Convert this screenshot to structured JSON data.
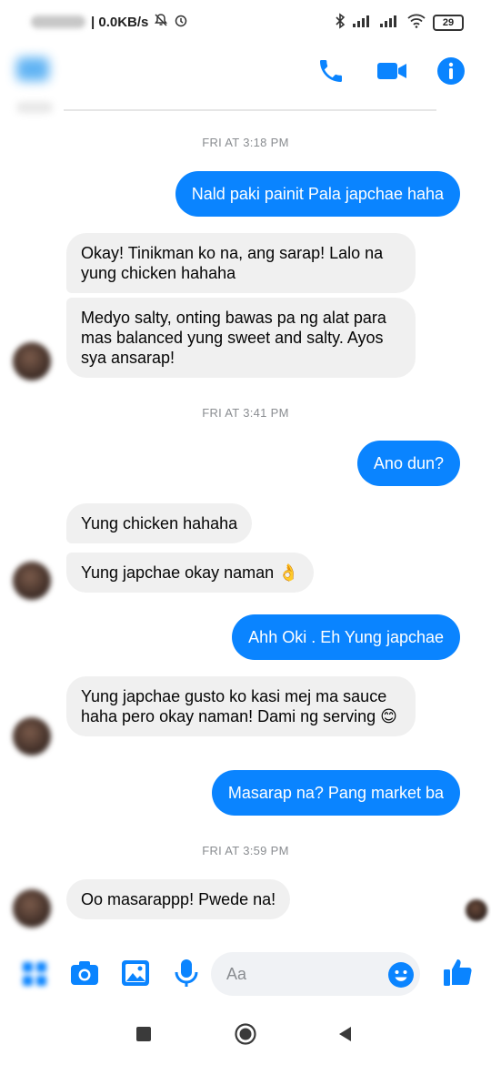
{
  "status_bar": {
    "time": "",
    "network_speed": "| 0.0KB/s",
    "battery": "29"
  },
  "header": {
    "icons": [
      "back-arrow-icon",
      "phone-icon",
      "video-call-icon",
      "info-icon"
    ],
    "accent_color": "#0a84ff"
  },
  "messages": {
    "ts1": "FRI AT 3:18 PM",
    "m1": "Nald paki painit Pala japchae haha",
    "m2": "Okay! Tinikman ko na, ang sarap! Lalo na yung chicken hahaha",
    "m3": "Medyo salty, onting bawas pa ng alat para mas balanced yung sweet and salty. Ayos sya ansarap!",
    "ts2": "FRI AT 3:41 PM",
    "m4": "Ano dun?",
    "m5": "Yung chicken hahaha",
    "m6": "Yung japchae okay naman 👌",
    "m7": "Ahh Oki . Eh Yung japchae",
    "m8": "Yung japchae gusto ko kasi mej ma sauce haha pero okay naman! Dami ng serving 😊",
    "m9": "Masarap na? Pang market ba",
    "ts3": "FRI AT 3:59 PM",
    "m10": "Oo masarappp! Pwede na!"
  },
  "composer": {
    "placeholder": "Aa",
    "icons": [
      "menu-icon",
      "camera-icon",
      "image-icon",
      "mic-icon",
      "emoji-icon",
      "like-icon"
    ]
  },
  "colors": {
    "outgoing_bubble": "#0a84ff",
    "incoming_bubble": "#f0f0f0",
    "timestamp": "#8a8d91"
  }
}
